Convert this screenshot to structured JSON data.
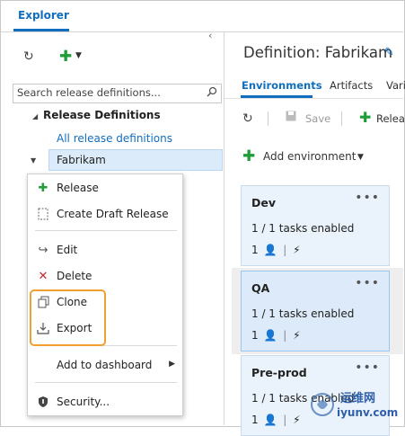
{
  "top_tab": {
    "label": "Explorer"
  },
  "left_pane": {
    "search": {
      "placeholder": "Search release definitions..."
    },
    "tree": {
      "root_label": "Release Definitions",
      "all_label": "All release definitions",
      "selected_label": "Fabrikam"
    }
  },
  "context_menu": {
    "items": [
      {
        "label": "Release",
        "icon": "plus-icon"
      },
      {
        "label": "Create Draft Release",
        "icon": "draft-page-icon"
      },
      {
        "label": "Edit",
        "icon": "edit-arrow-icon"
      },
      {
        "label": "Delete",
        "icon": "delete-x-icon"
      },
      {
        "label": "Clone",
        "icon": "clone-icon"
      },
      {
        "label": "Export",
        "icon": "export-icon"
      },
      {
        "label": "Add to dashboard",
        "icon": "submenu-arrow-icon"
      },
      {
        "label": "Security...",
        "icon": "shield-icon"
      }
    ]
  },
  "right_pane": {
    "title": "Definition: Fabrikam",
    "tabs": [
      "Environments",
      "Artifacts",
      "Vari"
    ],
    "toolbar": {
      "save_label": "Save",
      "release_label": "Releas"
    },
    "add_environment_label": "Add environment",
    "environments": [
      {
        "name": "Dev",
        "tasks": "1 / 1 tasks enabled",
        "count": "1"
      },
      {
        "name": "QA",
        "tasks": "1 / 1 tasks enabled",
        "count": "1"
      },
      {
        "name": "Pre-prod",
        "tasks": "1 / 1 tasks enabled",
        "count": "1"
      }
    ]
  },
  "watermark": {
    "brand": "运维网",
    "site": "iyunv.com"
  },
  "colors": {
    "accent": "#106ebe",
    "green": "#1e9e37",
    "highlight": "#f0a030",
    "delete": "#c4262e"
  }
}
